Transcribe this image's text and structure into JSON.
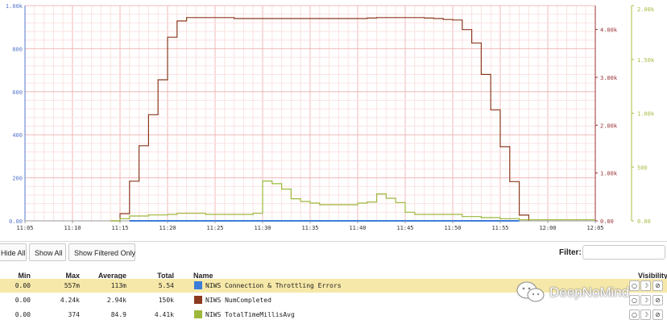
{
  "chart_data": {
    "type": "line",
    "x_ticks": [
      "11:05",
      "11:10",
      "11:15",
      "11:20",
      "11:25",
      "11:30",
      "11:35",
      "11:40",
      "11:45",
      "11:50",
      "11:55",
      "12:00",
      "12:05"
    ],
    "x_range": [
      "11:05",
      "12:05"
    ],
    "grid": true,
    "axes": {
      "left": {
        "ticks": [
          "1.00k",
          "800",
          "600",
          "400",
          "200",
          "0.00"
        ],
        "range": [
          0,
          1000
        ],
        "color": "#5577cc"
      },
      "right1": {
        "ticks": [
          "4.00k",
          "3.00k",
          "2.00k",
          "1.00k",
          "0.00"
        ],
        "range": [
          0,
          4500
        ],
        "color": "#993333"
      },
      "right2": {
        "ticks": [
          "2.00k",
          "1.50k",
          "1.00k",
          "500",
          "0.00"
        ],
        "range": [
          0,
          2000
        ],
        "color": "#a8bb44"
      }
    },
    "series": [
      {
        "name": "NIWS Connection & Throttling Errors",
        "axis": "left",
        "color": "#3b7dd8",
        "points": [
          [
            "11:16",
            0
          ],
          [
            "11:57",
            0
          ]
        ]
      },
      {
        "name": "NIWS NumCompleted",
        "axis": "right1",
        "color": "#8b3a1e",
        "points": [
          [
            "11:14",
            0
          ],
          [
            "11:15",
            150
          ],
          [
            "11:16",
            830
          ],
          [
            "11:17",
            1570
          ],
          [
            "11:18",
            2220
          ],
          [
            "11:19",
            2950
          ],
          [
            "11:20",
            3840
          ],
          [
            "11:21",
            4180
          ],
          [
            "11:22",
            4250
          ],
          [
            "11:26",
            4250
          ],
          [
            "11:27",
            4230
          ],
          [
            "11:41",
            4240
          ],
          [
            "11:42",
            4250
          ],
          [
            "11:47",
            4240
          ],
          [
            "11:48",
            4230
          ],
          [
            "11:49",
            4210
          ],
          [
            "11:50",
            4200
          ],
          [
            "11:51",
            4000
          ],
          [
            "11:52",
            3720
          ],
          [
            "11:53",
            3060
          ],
          [
            "11:54",
            2320
          ],
          [
            "11:55",
            1550
          ],
          [
            "11:56",
            820
          ],
          [
            "11:57",
            120
          ],
          [
            "11:58",
            0
          ]
        ]
      },
      {
        "name": "NIWS TotalTimeMillisAvg",
        "axis": "right2",
        "color": "#9cb83a",
        "points": [
          [
            "11:14",
            0
          ],
          [
            "11:15",
            20
          ],
          [
            "11:16",
            45
          ],
          [
            "11:18",
            55
          ],
          [
            "11:20",
            60
          ],
          [
            "11:21",
            70
          ],
          [
            "11:24",
            60
          ],
          [
            "11:26",
            60
          ],
          [
            "11:29",
            70
          ],
          [
            "11:30",
            370
          ],
          [
            "11:31",
            345
          ],
          [
            "11:32",
            295
          ],
          [
            "11:33",
            205
          ],
          [
            "11:34",
            180
          ],
          [
            "11:35",
            165
          ],
          [
            "11:36",
            150
          ],
          [
            "11:39",
            150
          ],
          [
            "11:40",
            165
          ],
          [
            "11:41",
            175
          ],
          [
            "11:42",
            250
          ],
          [
            "11:43",
            210
          ],
          [
            "11:44",
            170
          ],
          [
            "11:45",
            80
          ],
          [
            "11:46",
            60
          ],
          [
            "11:50",
            60
          ],
          [
            "11:51",
            40
          ],
          [
            "11:53",
            30
          ],
          [
            "11:55",
            20
          ],
          [
            "11:57",
            10
          ],
          [
            "12:05",
            10
          ]
        ]
      }
    ]
  },
  "toolbar": {
    "hide_all": "Hide All",
    "show_all": "Show All",
    "show_filtered": "Show Filtered Only",
    "filter_label": "Filter:",
    "filter_value": ""
  },
  "legend": {
    "headers": {
      "min": "Min",
      "max": "Max",
      "average": "Average",
      "total": "Total",
      "name": "Name",
      "visibility": "Visibility"
    },
    "rows": [
      {
        "min": "0.00",
        "max": "557m",
        "average": "113m",
        "total": "5.54",
        "name": "NIWS Connection & Throttling Errors",
        "color": "#3b7dd8",
        "highlighted": true
      },
      {
        "min": "0.00",
        "max": "4.24k",
        "average": "2.94k",
        "total": "150k",
        "name": "NIWS NumCompleted",
        "color": "#8b3a1e",
        "highlighted": false
      },
      {
        "min": "0.00",
        "max": "374",
        "average": "84.9",
        "total": "4.41k",
        "name": "NIWS TotalTimeMillisAvg",
        "color": "#9cb83a",
        "highlighted": false
      }
    ]
  },
  "watermark": {
    "text": "DeepNoMind",
    "icon": "wechat-icon"
  }
}
